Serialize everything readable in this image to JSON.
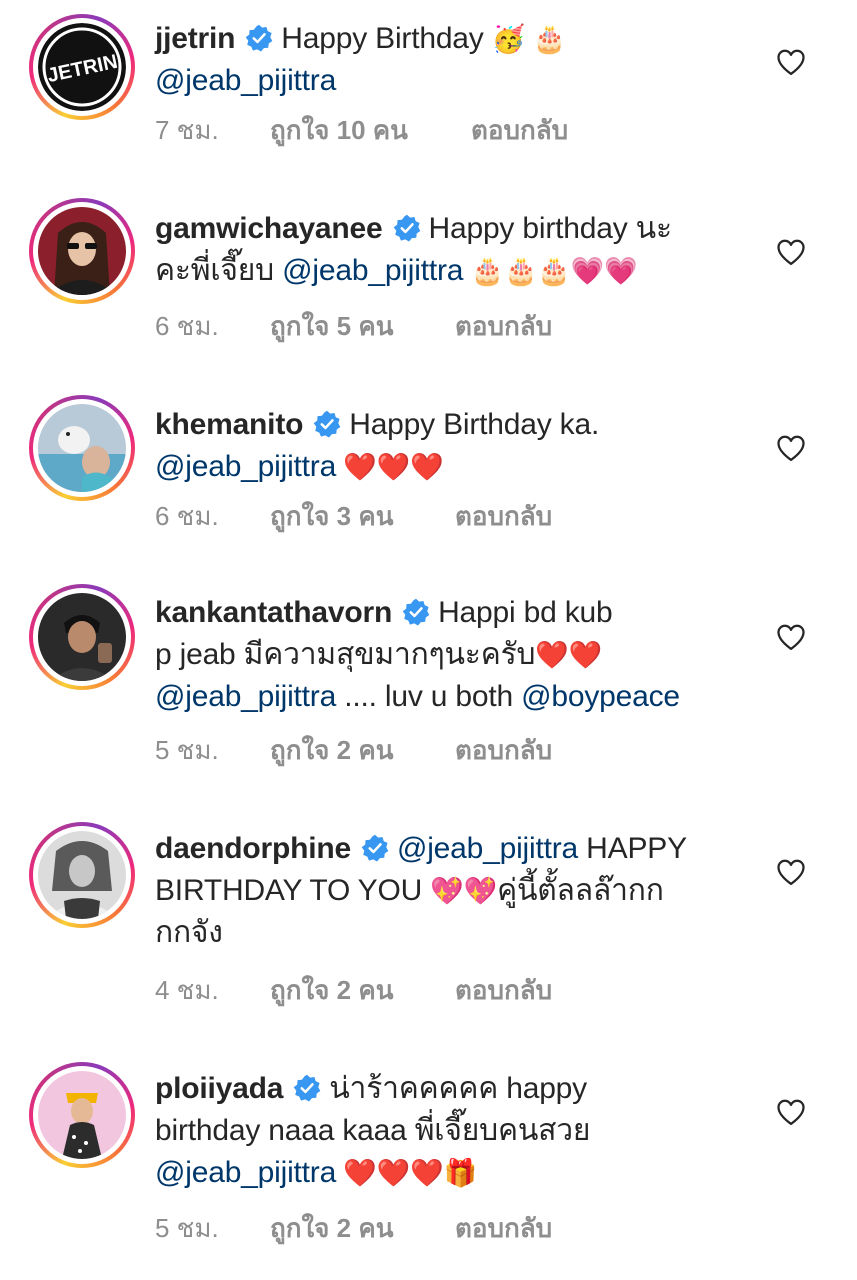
{
  "comments": [
    {
      "username": "jjetrin",
      "avatar_label": "JETRIN",
      "text_parts": [
        "Happy Birthday ",
        "🥳 🎂",
        "@jeab_pijittra"
      ],
      "time": "7 ชม.",
      "likes": "ถูกใจ 10 คน",
      "reply": "ตอบกลับ"
    },
    {
      "username": "gamwichayanee",
      "text_parts": [
        "Happy birthday นะ",
        "คะพี่เจี๊ยบ ",
        "@jeab_pijittra",
        " 🎂🎂🎂💗💗"
      ],
      "time": "6 ชม.",
      "likes": "ถูกใจ 5 คน",
      "reply": "ตอบกลับ"
    },
    {
      "username": "khemanito",
      "text_parts": [
        "Happy Birthday ka.",
        "@jeab_pijittra",
        " ❤️❤️❤️"
      ],
      "time": "6 ชม.",
      "likes": "ถูกใจ 3 คน",
      "reply": "ตอบกลับ"
    },
    {
      "username": "kankantathavorn",
      "text_parts": [
        "Happi bd kub",
        "p jeab มีความสุขมากๆนะครับ",
        "❤️❤️",
        "@jeab_pijittra",
        " .... luv u both ",
        "@boypeace"
      ],
      "time": "5 ชม.",
      "likes": "ถูกใจ 2 คน",
      "reply": "ตอบกลับ"
    },
    {
      "username": "daendorphine",
      "text_parts": [
        "@jeab_pijittra",
        " HAPPY",
        "BIRTHDAY TO YOU ",
        "💖💖",
        "คู่นี้ตั้ลลล๊ากก",
        "กกจัง"
      ],
      "time": "4 ชม.",
      "likes": "ถูกใจ 2 คน",
      "reply": "ตอบกลับ"
    },
    {
      "username": "ploiiyada",
      "text_parts": [
        "น่าร้าคคคคค happy",
        "birthday naaa kaaa พี่เจี๊ยบคนสวย",
        "@jeab_pijittra",
        " ❤️❤️❤️🎁"
      ],
      "time": "5 ชม.",
      "likes": "ถูกใจ 2 คน",
      "reply": "ตอบกลับ"
    }
  ],
  "icons": {
    "verified_badge": "verified-badge-icon",
    "like": "heart-outline-icon"
  },
  "colors": {
    "mention": "#00376b",
    "verified": "#3897f0",
    "meta": "#8e8e8e"
  }
}
